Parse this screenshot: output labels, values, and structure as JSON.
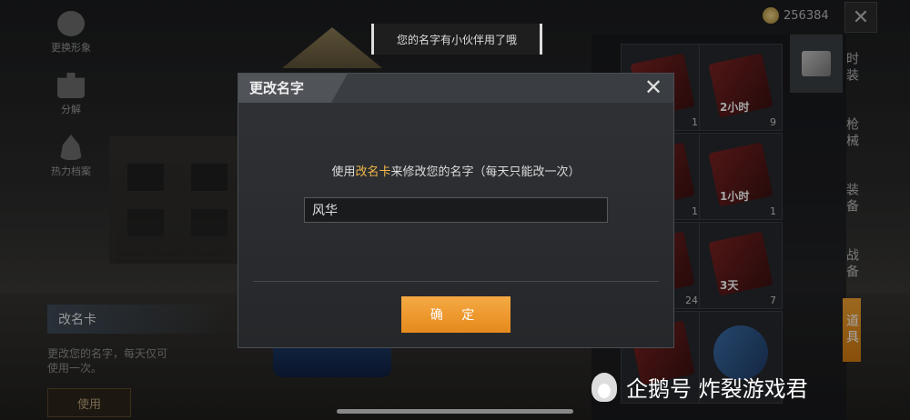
{
  "left_menu": {
    "items": [
      {
        "label": "更换形象",
        "icon": "person-icon"
      },
      {
        "label": "分解",
        "icon": "puzzle-icon"
      },
      {
        "label": "热力档案",
        "icon": "flame-icon"
      }
    ]
  },
  "item_panel": {
    "title": "改名卡",
    "description": "更改您的名字，每天仅可使用一次。",
    "use_label": "使用"
  },
  "coins": {
    "amount": "256384"
  },
  "toast": {
    "text": "您的名字有小伙伴用了哦"
  },
  "inventory": {
    "counts": [
      "1",
      "9",
      "1",
      "1",
      "24",
      "7"
    ],
    "badges": [
      "2小时",
      "1小时",
      "3天"
    ]
  },
  "tabs": [
    {
      "label": "时装"
    },
    {
      "label": "枪械"
    },
    {
      "label": "装备"
    },
    {
      "label": "战备"
    },
    {
      "label": "道具",
      "active": true
    }
  ],
  "modal": {
    "title": "更改名字",
    "instruction_prefix": "使用",
    "instruction_highlight": "改名卡",
    "instruction_suffix": "来修改您的名字（每天只能改一次）",
    "name_value": "风华",
    "confirm_label": "确 定",
    "highlight_color": "#f2b84a",
    "button_color": "#f5a943"
  },
  "watermark": {
    "text": "企鹅号 炸裂游戏君"
  }
}
